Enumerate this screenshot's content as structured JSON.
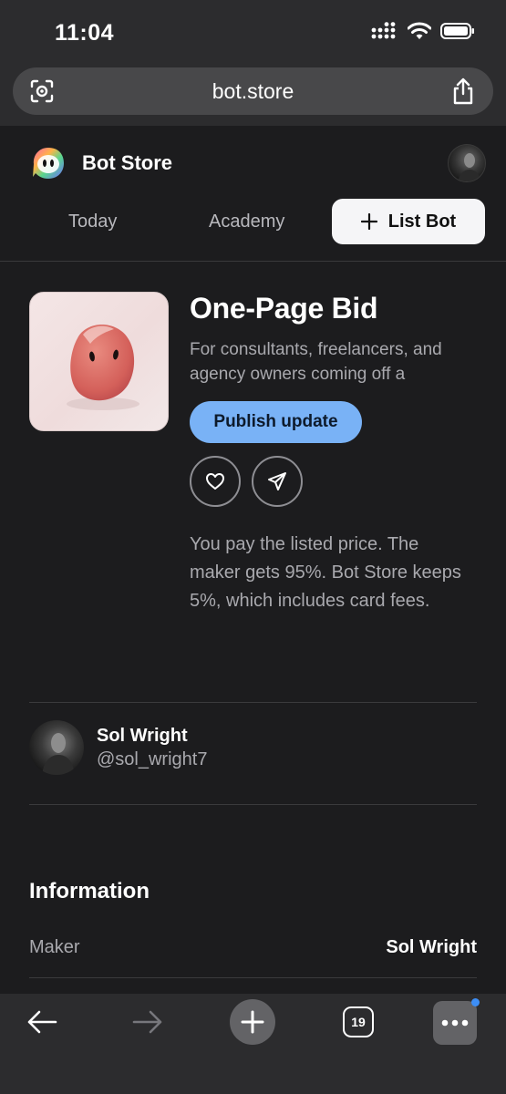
{
  "status_bar": {
    "time": "11:04"
  },
  "browser": {
    "url": "bot.store",
    "tab_count": "19"
  },
  "site": {
    "brand_name": "Bot Store",
    "nav": {
      "today": "Today",
      "academy": "Academy",
      "list_bot": "List Bot"
    }
  },
  "product": {
    "title": "One-Page Bid",
    "description": "For consultants, freelancers, and agency owners coming off a",
    "publish_label": "Publish update",
    "fee_note": "You pay the listed price. The maker gets 95%. Bot Store keeps 5%, which includes card fees."
  },
  "maker": {
    "name": "Sol Wright",
    "handle": "@sol_wright7"
  },
  "information": {
    "heading": "Information",
    "rows": [
      {
        "label": "Maker",
        "value": "Sol Wright"
      }
    ]
  },
  "icons": {
    "status": [
      "signal-icon",
      "wifi-icon",
      "battery-icon"
    ],
    "toolbar": [
      "back-arrow-icon",
      "forward-arrow-icon",
      "plus-icon",
      "tabs-icon",
      "more-icon"
    ],
    "product_actions": [
      "heart-icon",
      "send-icon"
    ]
  },
  "colors": {
    "accent": "#79b2f6",
    "notification_dot": "#3d8ef5",
    "background": "#1c1c1e"
  }
}
